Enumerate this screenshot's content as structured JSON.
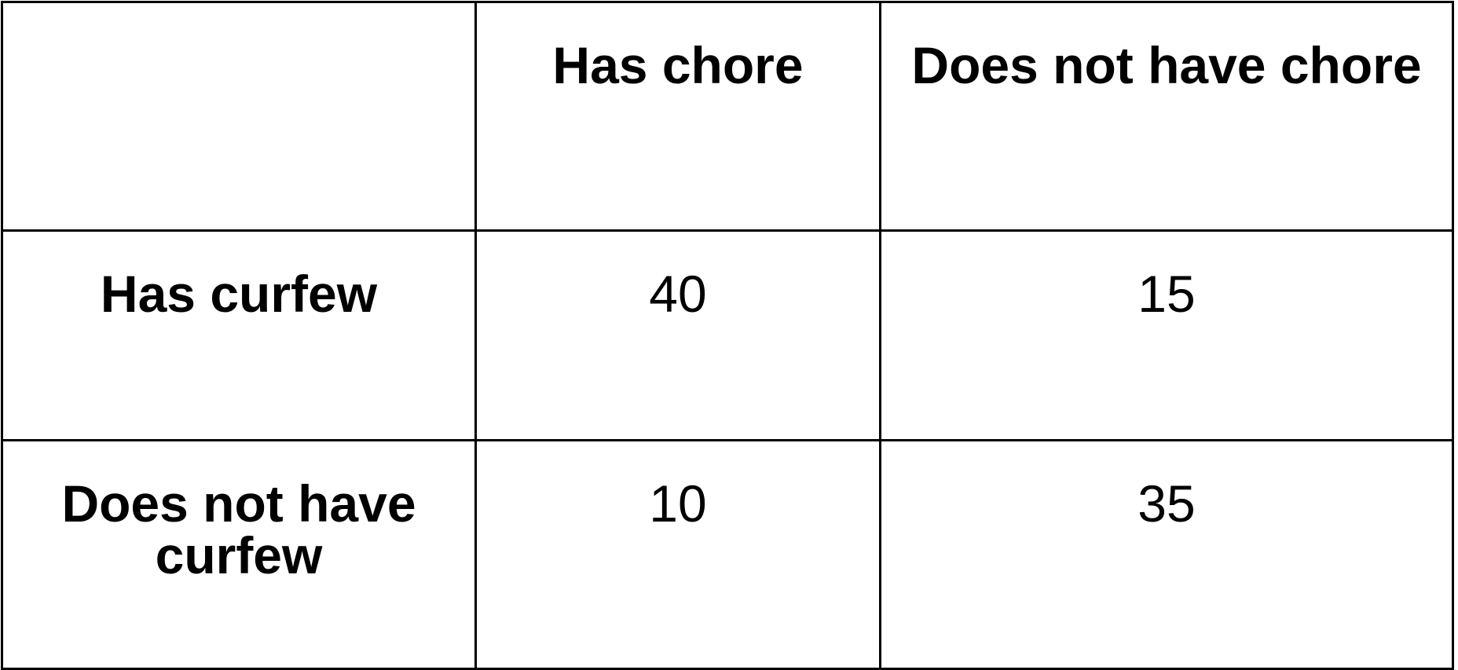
{
  "table": {
    "columns": [
      "",
      "Has chore",
      "Does not have chore"
    ],
    "rows": [
      {
        "label": "Has curfew",
        "values": [
          "40",
          "15"
        ]
      },
      {
        "label": "Does not have curfew",
        "values": [
          "10",
          "35"
        ]
      }
    ]
  }
}
